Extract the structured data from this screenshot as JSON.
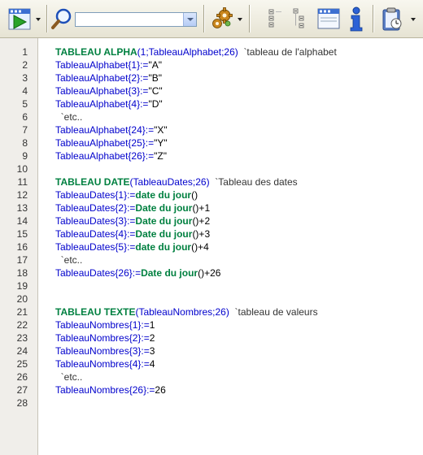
{
  "toolbar": {
    "buttons": [
      {
        "id": "run",
        "icon": "run-method-icon"
      },
      {
        "id": "search",
        "icon": "search-magnifier-icon"
      },
      {
        "id": "debug",
        "icon": "gear-icon"
      },
      {
        "id": "list",
        "icon": "list-view-icon"
      },
      {
        "id": "form",
        "icon": "form-view-icon"
      },
      {
        "id": "info",
        "icon": "info-icon"
      },
      {
        "id": "clipboard",
        "icon": "clipboard-icon"
      }
    ],
    "search_value": ""
  },
  "editor": {
    "line_numbers": [
      "1",
      "2",
      "3",
      "4",
      "5",
      "6",
      "7",
      "8",
      "9",
      "10",
      "11",
      "12",
      "13",
      "14",
      "15",
      "16",
      "17",
      "18",
      "19",
      "20",
      "21",
      "22",
      "23",
      "24",
      "25",
      "26",
      "27",
      "28"
    ],
    "lines": [
      [
        {
          "t": "TABLEAU ALPHA",
          "c": "kw"
        },
        {
          "t": "(1;TableauAlphabet;26)  ",
          "c": "var"
        },
        {
          "t": "`tableau de l'alphabet",
          "c": "cmt"
        }
      ],
      [
        {
          "t": "TableauAlphabet{1}:=",
          "c": "var"
        },
        {
          "t": "\"A\"",
          "c": "str"
        }
      ],
      [
        {
          "t": "TableauAlphabet{2}:=",
          "c": "var"
        },
        {
          "t": "\"B\"",
          "c": "str"
        }
      ],
      [
        {
          "t": "TableauAlphabet{3}:=",
          "c": "var"
        },
        {
          "t": "\"C\"",
          "c": "str"
        }
      ],
      [
        {
          "t": "TableauAlphabet{4}:=",
          "c": "var"
        },
        {
          "t": "\"D\"",
          "c": "str"
        }
      ],
      [
        {
          "t": "  `etc..",
          "c": "cmt"
        }
      ],
      [
        {
          "t": "TableauAlphabet{24}:=",
          "c": "var"
        },
        {
          "t": "\"X\"",
          "c": "str"
        }
      ],
      [
        {
          "t": "TableauAlphabet{25}:=",
          "c": "var"
        },
        {
          "t": "\"Y\"",
          "c": "str"
        }
      ],
      [
        {
          "t": "TableauAlphabet{26}:=",
          "c": "var"
        },
        {
          "t": "\"Z\"",
          "c": "str"
        }
      ],
      [],
      [
        {
          "t": "TABLEAU DATE",
          "c": "kw"
        },
        {
          "t": "(TableauDates;26)  ",
          "c": "var"
        },
        {
          "t": "`Tableau des dates",
          "c": "cmt"
        }
      ],
      [
        {
          "t": "TableauDates{1}:=",
          "c": "var"
        },
        {
          "t": "date du jour",
          "c": "kw"
        },
        {
          "t": "()",
          "c": "str"
        }
      ],
      [
        {
          "t": "TableauDates{2}:=",
          "c": "var"
        },
        {
          "t": "Date du jour",
          "c": "kw"
        },
        {
          "t": "()+1",
          "c": "str"
        }
      ],
      [
        {
          "t": "TableauDates{3}:=",
          "c": "var"
        },
        {
          "t": "Date du jour",
          "c": "kw"
        },
        {
          "t": "()+2",
          "c": "str"
        }
      ],
      [
        {
          "t": "TableauDates{4}:=",
          "c": "var"
        },
        {
          "t": "Date du jour",
          "c": "kw"
        },
        {
          "t": "()+3",
          "c": "str"
        }
      ],
      [
        {
          "t": "TableauDates{5}:=",
          "c": "var"
        },
        {
          "t": "date du jour",
          "c": "kw"
        },
        {
          "t": "()+4",
          "c": "str"
        }
      ],
      [
        {
          "t": "  `etc..",
          "c": "cmt"
        }
      ],
      [
        {
          "t": "TableauDates{26}:=",
          "c": "var"
        },
        {
          "t": "Date du jour",
          "c": "kw"
        },
        {
          "t": "()+26",
          "c": "str"
        }
      ],
      [],
      [],
      [
        {
          "t": "TABLEAU TEXTE",
          "c": "kw"
        },
        {
          "t": "(TableauNombres;26)  ",
          "c": "var"
        },
        {
          "t": "`tableau de valeurs",
          "c": "cmt"
        }
      ],
      [
        {
          "t": "TableauNombres{1}:=",
          "c": "var"
        },
        {
          "t": "1",
          "c": "str"
        }
      ],
      [
        {
          "t": "TableauNombres{2}:=",
          "c": "var"
        },
        {
          "t": "2",
          "c": "str"
        }
      ],
      [
        {
          "t": "TableauNombres{3}:=",
          "c": "var"
        },
        {
          "t": "3",
          "c": "str"
        }
      ],
      [
        {
          "t": "TableauNombres{4}:=",
          "c": "var"
        },
        {
          "t": "4",
          "c": "str"
        }
      ],
      [
        {
          "t": "  `etc..",
          "c": "cmt"
        }
      ],
      [
        {
          "t": "TableauNombres{26}:=",
          "c": "var"
        },
        {
          "t": "26",
          "c": "str"
        }
      ],
      []
    ]
  },
  "colors": {
    "keyword": "#008040",
    "variable": "#0000cc",
    "comment": "#333333",
    "literal": "#000000",
    "gutter": "#f0eeea"
  }
}
